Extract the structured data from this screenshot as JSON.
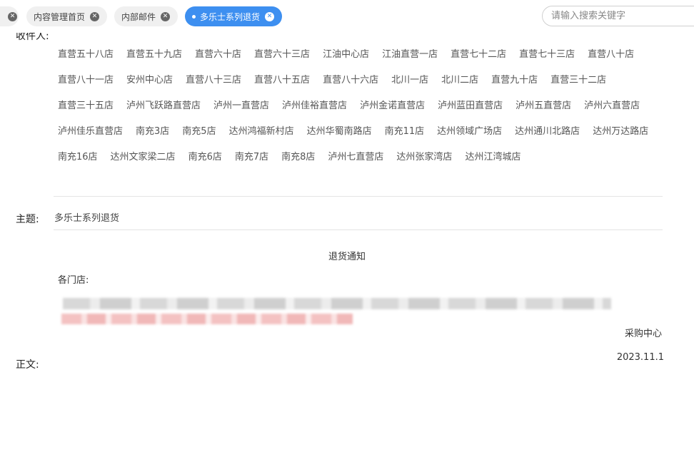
{
  "tabs": [
    {
      "label": "",
      "active": false
    },
    {
      "label": "内容管理首页",
      "active": false
    },
    {
      "label": "内部邮件",
      "active": false
    },
    {
      "label": "多乐士系列退货",
      "active": true
    }
  ],
  "search": {
    "placeholder": "请输入搜索关键字"
  },
  "form": {
    "recipients_label": "收件人:",
    "recipients": [
      "直营五十八店",
      "直营五十九店",
      "直营六十店",
      "直营六十三店",
      "江油中心店",
      "江油直营一店",
      "直营七十二店",
      "直营七十三店",
      "直营八十店",
      "直营八十一店",
      "安州中心店",
      "直营八十三店",
      "直营八十五店",
      "直营八十六店",
      "北川一店",
      "北川二店",
      "直营九十店",
      "直营三十二店",
      "直营三十五店",
      "泸州飞跃路直营店",
      "泸州一直营店",
      "泸州佳裕直营店",
      "泸州金诺直营店",
      "泸州蓝田直营店",
      "泸州五直营店",
      "泸州六直营店",
      "泸州佳乐直营店",
      "南充3店",
      "南充5店",
      "达州鸿福新村店",
      "达州华蜀南路店",
      "南充11店",
      "达州领域广场店",
      "达州通川北路店",
      "达州万达路店",
      "南充16店",
      "达州文家梁二店",
      "南充6店",
      "南充7店",
      "南充8店",
      "泸州七直营店",
      "达州张家湾店",
      "达州江湾城店"
    ],
    "subject_label": "主题:",
    "subject": "多乐士系列退货",
    "body_label": "正文:",
    "body": {
      "title": "退货通知",
      "greeting": "各门店:",
      "signature_dept": "采购中心",
      "signature_date": "2023.11.1"
    }
  }
}
